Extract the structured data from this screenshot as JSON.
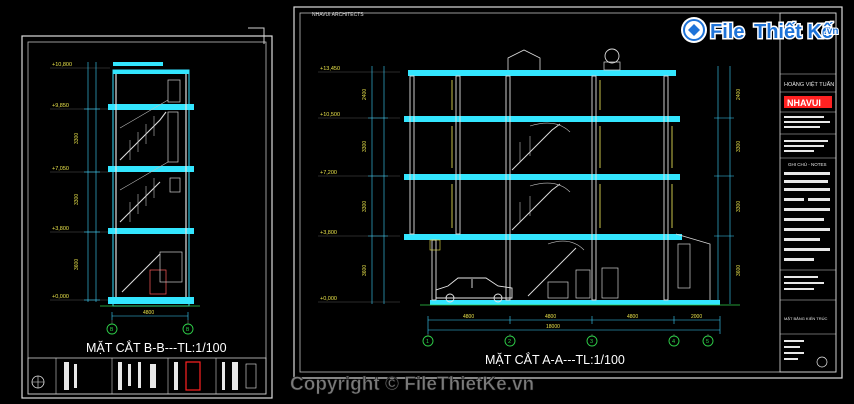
{
  "left_sheet": {
    "title": "MẶT CẮT B-B---TL:1/100",
    "levels": [
      "+10,800",
      "+9,850",
      "+7,050",
      "+3,800",
      "+0,000"
    ],
    "side_dims": [
      "3300",
      "3300",
      "3600"
    ],
    "bottom_dim": "4800",
    "grid_bubbles": [
      "B",
      "B"
    ]
  },
  "right_sheet": {
    "header_text": "NHAVUI ARCHITECTS",
    "title": "MẶT CẮT A-A---TL:1/100",
    "levels": [
      "+13,450",
      "+10,500",
      "+7,200",
      "+3,800",
      "+0,000"
    ],
    "left_dims": [
      "2400",
      "3300",
      "3300",
      "3600"
    ],
    "right_dims": [
      "2400",
      "3300",
      "3300",
      "3600"
    ],
    "span_dims": [
      "4800",
      "4800",
      "4800",
      "2000"
    ],
    "total_dim": "18000",
    "grid_bubbles": [
      "1",
      "2",
      "3",
      "4",
      "5"
    ]
  },
  "title_block": {
    "owner_name": "HOÀNG VIỆT TUẤN",
    "logo_text": "NHAVUI",
    "notes_label": "GHI CHÚ - NOTES",
    "drawing_name": "MẶT BẰNG KIẾN TRÚC"
  },
  "watermark": {
    "brand_a": "File",
    "brand_b": "Thiết Kế",
    "brand_c": ".vn",
    "copyright": "Copyright © FileThietKe.vn"
  },
  "colors": {
    "cyan": "#35e0ff",
    "slab": "#33e6ff",
    "frame": "#d8d8d8",
    "green": "#2fd24a",
    "red": "#ff3a3a",
    "yellow": "#e8e24a",
    "logo_red": "#ff2222"
  }
}
